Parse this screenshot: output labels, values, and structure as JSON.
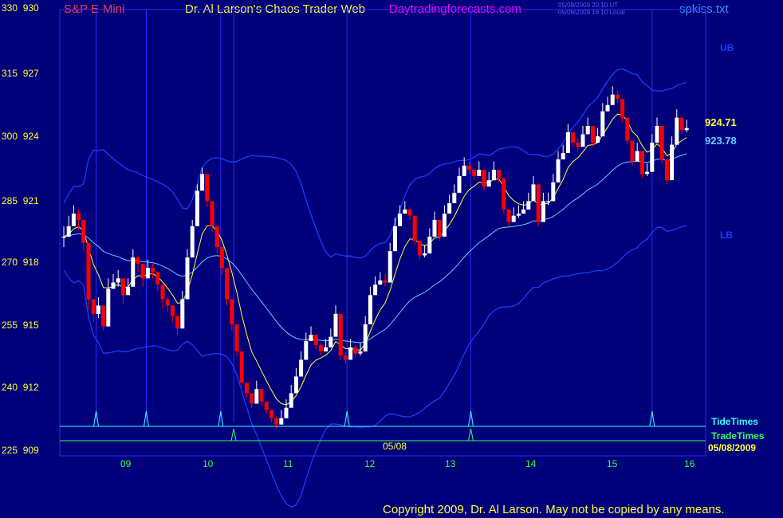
{
  "header": {
    "instrument": "S&P E-Mini",
    "title": "Dr. Al Larson's Chaos Trader Web",
    "site": "Daytradingforecasts.com",
    "timestamp_line1": "05/08/2009 20:10 UT",
    "timestamp_line2": "05/08/2009 16:10 Local",
    "file": "spkiss.txt"
  },
  "copyright": "Copyright 2009, Dr. Al Larson. May not be copied by any means.",
  "colors": {
    "background": "#00007a",
    "up_bar": "#ffffff",
    "down_bar": "#ff0000",
    "fast_ma": "#ffff33",
    "slow_ma": "#66ccff",
    "bands": "#1a3cff",
    "tide": "#33ffff",
    "trade": "#33ff66",
    "grid": "#2a2aff"
  },
  "chart_data": {
    "type": "candlestick",
    "y_left_labels": [
      "330",
      "315",
      "300",
      "285",
      "270",
      "255",
      "240",
      "225"
    ],
    "y_right_labels": [
      "930",
      "927",
      "924",
      "921",
      "918",
      "915",
      "912",
      "909"
    ],
    "ylim": [
      909,
      930
    ],
    "x_ticks": [
      "09",
      "10",
      "11",
      "12",
      "13",
      "14",
      "15",
      "16"
    ],
    "last_price": "924.71",
    "ma_value": "923.78",
    "band_labels": [
      "UB",
      "LB"
    ],
    "legend": [
      "TideTimes",
      "TradeTimes"
    ],
    "trade_date_label": "05/08",
    "date_label": "05/08/2009",
    "vertical_markers_x": [
      8.68,
      9.3,
      10.22,
      10.38,
      11.78,
      13.31,
      15.55
    ],
    "tide_spikes_x": [
      8.68,
      9.3,
      10.22,
      11.78,
      13.31,
      15.55
    ],
    "trade_spikes_x": [
      10.38,
      13.31
    ],
    "closes": [
      919.5,
      920,
      920.6,
      920.3,
      919.2,
      916.5,
      915.8,
      916.2,
      915.2,
      917,
      917.3,
      917.5,
      916.7,
      917.1,
      918.5,
      918.2,
      917.5,
      918,
      917.8,
      917.2,
      916.5,
      916.2,
      915.7,
      915.1,
      916.5,
      918.5,
      920,
      921.7,
      922.5,
      921.2,
      920,
      919,
      918,
      916.5,
      915.3,
      914,
      912.5,
      912,
      911.5,
      912.2,
      911.6,
      911.2,
      910.8,
      910.5,
      910.8,
      911.3,
      912,
      912.8,
      913.6,
      914.5,
      914.8,
      914.3,
      914,
      914.2,
      914.7,
      915.8,
      913.8,
      913.6,
      914.2,
      913.9,
      914,
      915.3,
      916.7,
      917.2,
      917.4,
      917.3,
      918.8,
      920,
      920.6,
      920.8,
      920.5,
      919.3,
      918.6,
      918.7,
      919.5,
      920.3,
      919.5,
      920.6,
      921.1,
      921.6,
      922.4,
      922.9,
      922.7,
      922.4,
      922.7,
      921.9,
      922.2,
      922.7,
      922.3,
      920.8,
      920.2,
      920.5,
      920.6,
      920.8,
      921.2,
      922,
      920.2,
      921.2,
      921.2,
      922.1,
      923.2,
      923.5,
      924.5,
      924,
      923.8,
      924.4,
      924.8,
      924,
      924.3,
      925.5,
      925.8,
      926.3,
      926.1,
      925.2,
      924.1,
      923.1,
      923.6,
      922.5,
      922.6,
      924,
      924.8,
      923.2,
      922.2,
      923.9,
      925.2,
      924.6,
      924.7
    ],
    "lows": [
      919,
      919.5,
      920,
      919.8,
      918.8,
      916,
      915.4,
      915.6,
      915,
      916.5,
      917,
      917.1,
      916.3,
      916.7,
      918,
      917.8,
      917.1,
      917.5,
      917.5,
      916.9,
      916.1,
      915.9,
      915.4,
      914.8,
      916,
      918,
      919.7,
      921.4,
      922.2,
      920.9,
      919.7,
      918.7,
      917.7,
      916.2,
      915,
      913.8,
      912.3,
      911.8,
      911.3,
      912,
      911.4,
      911,
      910.6,
      910.3,
      910.6,
      911.1,
      911.8,
      912.6,
      913.4,
      914.3,
      914.6,
      914.1,
      913.8,
      914,
      914.5,
      915.6,
      913.6,
      913.4,
      914,
      913.7,
      913.8,
      915.1,
      916.5,
      917,
      917.2,
      917.1,
      918.6,
      919.8,
      920.4,
      920.6,
      920.3,
      919.1,
      918.4,
      918.5,
      919.3,
      920.1,
      919.3,
      920.4,
      920.9,
      921.4,
      922.2,
      922.7,
      922.5,
      922.2,
      922.5,
      921.7,
      922,
      922.5,
      922.1,
      920.6,
      920,
      920.3,
      920.4,
      920.6,
      921,
      921.8,
      920,
      921,
      921,
      921.9,
      923,
      923.3,
      924.3,
      923.8,
      923.6,
      924.2,
      924.6,
      923.8,
      924.1,
      925.3,
      925.6,
      926.1,
      925.9,
      925,
      923.9,
      922.9,
      923.4,
      922.3,
      922.4,
      923.8,
      924.6,
      923,
      922,
      923.7,
      925,
      924.4,
      924.5
    ],
    "highs": [
      920,
      920.5,
      921,
      920.8,
      919.6,
      917,
      916.2,
      916.6,
      915.6,
      917.5,
      917.7,
      917.9,
      917.1,
      917.5,
      918.9,
      918.6,
      917.9,
      918.4,
      918.2,
      917.6,
      916.9,
      916.6,
      916.1,
      915.5,
      916.9,
      918.9,
      920.3,
      922,
      922.8,
      921.5,
      920.3,
      919.4,
      918.4,
      916.9,
      915.7,
      914.4,
      912.9,
      912.4,
      911.9,
      912.6,
      912,
      911.6,
      911.2,
      910.9,
      911.2,
      911.7,
      912.4,
      913.2,
      914,
      914.9,
      915.2,
      914.7,
      914.4,
      914.6,
      915.1,
      916.2,
      914.2,
      914,
      914.6,
      914.3,
      914.4,
      915.7,
      917.1,
      917.6,
      917.8,
      917.7,
      919.2,
      920.4,
      921,
      921.2,
      920.9,
      919.7,
      919,
      919.1,
      919.9,
      920.7,
      919.9,
      921,
      921.5,
      922,
      922.8,
      923.3,
      923.1,
      922.8,
      923.1,
      922.3,
      922.6,
      923.1,
      922.7,
      921.2,
      920.6,
      920.9,
      921,
      921.2,
      921.6,
      922.4,
      920.6,
      921.6,
      921.6,
      922.5,
      923.6,
      923.9,
      924.9,
      924.4,
      924.2,
      924.8,
      925.2,
      924.4,
      924.7,
      925.9,
      926.2,
      926.7,
      926.5,
      925.6,
      924.5,
      923.5,
      924,
      922.9,
      923,
      924.4,
      925.2,
      923.6,
      922.6,
      924.3,
      925.6,
      925,
      925.1
    ]
  }
}
